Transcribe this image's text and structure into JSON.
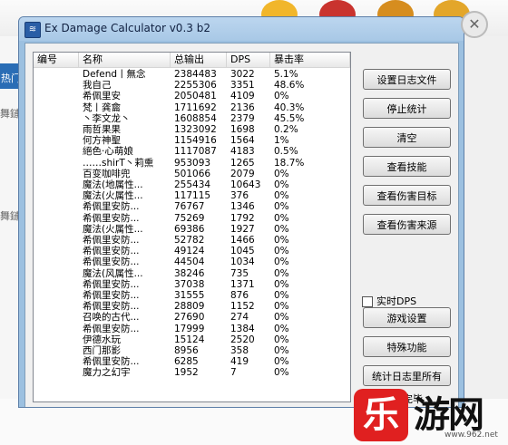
{
  "window": {
    "title": "Ex Damage Calculator v0.3 b2"
  },
  "background": {
    "left_labels": [
      "热门",
      "舞鏈",
      "舞鏈"
    ]
  },
  "table": {
    "headers": [
      "编号",
      "名称",
      "总输出",
      "DPS",
      "暴击率"
    ],
    "rows": [
      {
        "name": "Defend丨無念",
        "total": "2384483",
        "dps": "3022",
        "crit": "5.1%"
      },
      {
        "name": "我自己",
        "total": "2255306",
        "dps": "3351",
        "crit": "48.6%"
      },
      {
        "name": "希佩里安",
        "total": "2050481",
        "dps": "4109",
        "crit": "0%"
      },
      {
        "name": "梵丨龚龠",
        "total": "1711692",
        "dps": "2136",
        "crit": "40.3%"
      },
      {
        "name": "丶李文龙丶",
        "total": "1608854",
        "dps": "2379",
        "crit": "45.5%"
      },
      {
        "name": "雨哲果果",
        "total": "1323092",
        "dps": "1698",
        "crit": "0.2%"
      },
      {
        "name": "何方神聖",
        "total": "1154916",
        "dps": "1564",
        "crit": "1%"
      },
      {
        "name": "絕色·心萌娘",
        "total": "1117087",
        "dps": "4183",
        "crit": "0.5%"
      },
      {
        "name": "……shirT丶莉熏",
        "total": "953093",
        "dps": "1265",
        "crit": "18.7%"
      },
      {
        "name": "百变咖啡兜",
        "total": "501066",
        "dps": "2079",
        "crit": "0%"
      },
      {
        "name": "魔法(地属性...",
        "total": "255434",
        "dps": "10643",
        "crit": "0%"
      },
      {
        "name": "魔法(火属性...",
        "total": "117115",
        "dps": "376",
        "crit": "0%"
      },
      {
        "name": "希佩里安防...",
        "total": "76767",
        "dps": "1346",
        "crit": "0%"
      },
      {
        "name": "希佩里安防...",
        "total": "75269",
        "dps": "1792",
        "crit": "0%"
      },
      {
        "name": "魔法(火属性...",
        "total": "69386",
        "dps": "1927",
        "crit": "0%"
      },
      {
        "name": "希佩里安防...",
        "total": "52782",
        "dps": "1466",
        "crit": "0%"
      },
      {
        "name": "希佩里安防...",
        "total": "49124",
        "dps": "1045",
        "crit": "0%"
      },
      {
        "name": "希佩里安防...",
        "total": "44504",
        "dps": "1034",
        "crit": "0%"
      },
      {
        "name": "魔法(风属性...",
        "total": "38246",
        "dps": "735",
        "crit": "0%"
      },
      {
        "name": "希佩里安防...",
        "total": "37038",
        "dps": "1371",
        "crit": "0%"
      },
      {
        "name": "希佩里安防...",
        "total": "31555",
        "dps": "876",
        "crit": "0%"
      },
      {
        "name": "希佩里安防...",
        "total": "28809",
        "dps": "1152",
        "crit": "0%"
      },
      {
        "name": "召唤的古代...",
        "total": "27690",
        "dps": "274",
        "crit": "0%"
      },
      {
        "name": "希佩里安防...",
        "total": "17999",
        "dps": "1384",
        "crit": "0%"
      },
      {
        "name": "伊德水玩",
        "total": "15124",
        "dps": "2520",
        "crit": "0%"
      },
      {
        "name": "西门那影",
        "total": "8956",
        "dps": "358",
        "crit": "0%"
      },
      {
        "name": "希佩里安防...",
        "total": "6285",
        "dps": "419",
        "crit": "0%"
      },
      {
        "name": "魔力之幻宇",
        "total": "1952",
        "dps": "7",
        "crit": "0%"
      }
    ]
  },
  "buttons": {
    "set_log_file": "设置日志文件",
    "stop_stats": "停止统计",
    "clear": "清空",
    "view_skills": "查看技能",
    "view_damage_target": "查看伤害目标",
    "view_damage_source": "查看伤害来源",
    "game_settings": "游戏设置",
    "special_features": "特殊功能",
    "stats_all_logs": "统计日志里所有"
  },
  "realtime_dps": {
    "label": "实时DPS",
    "checked": false
  },
  "status": {
    "text": "系统准备完毕"
  },
  "logo": {
    "char": "乐",
    "text": "游网",
    "url": "www.962.net"
  }
}
